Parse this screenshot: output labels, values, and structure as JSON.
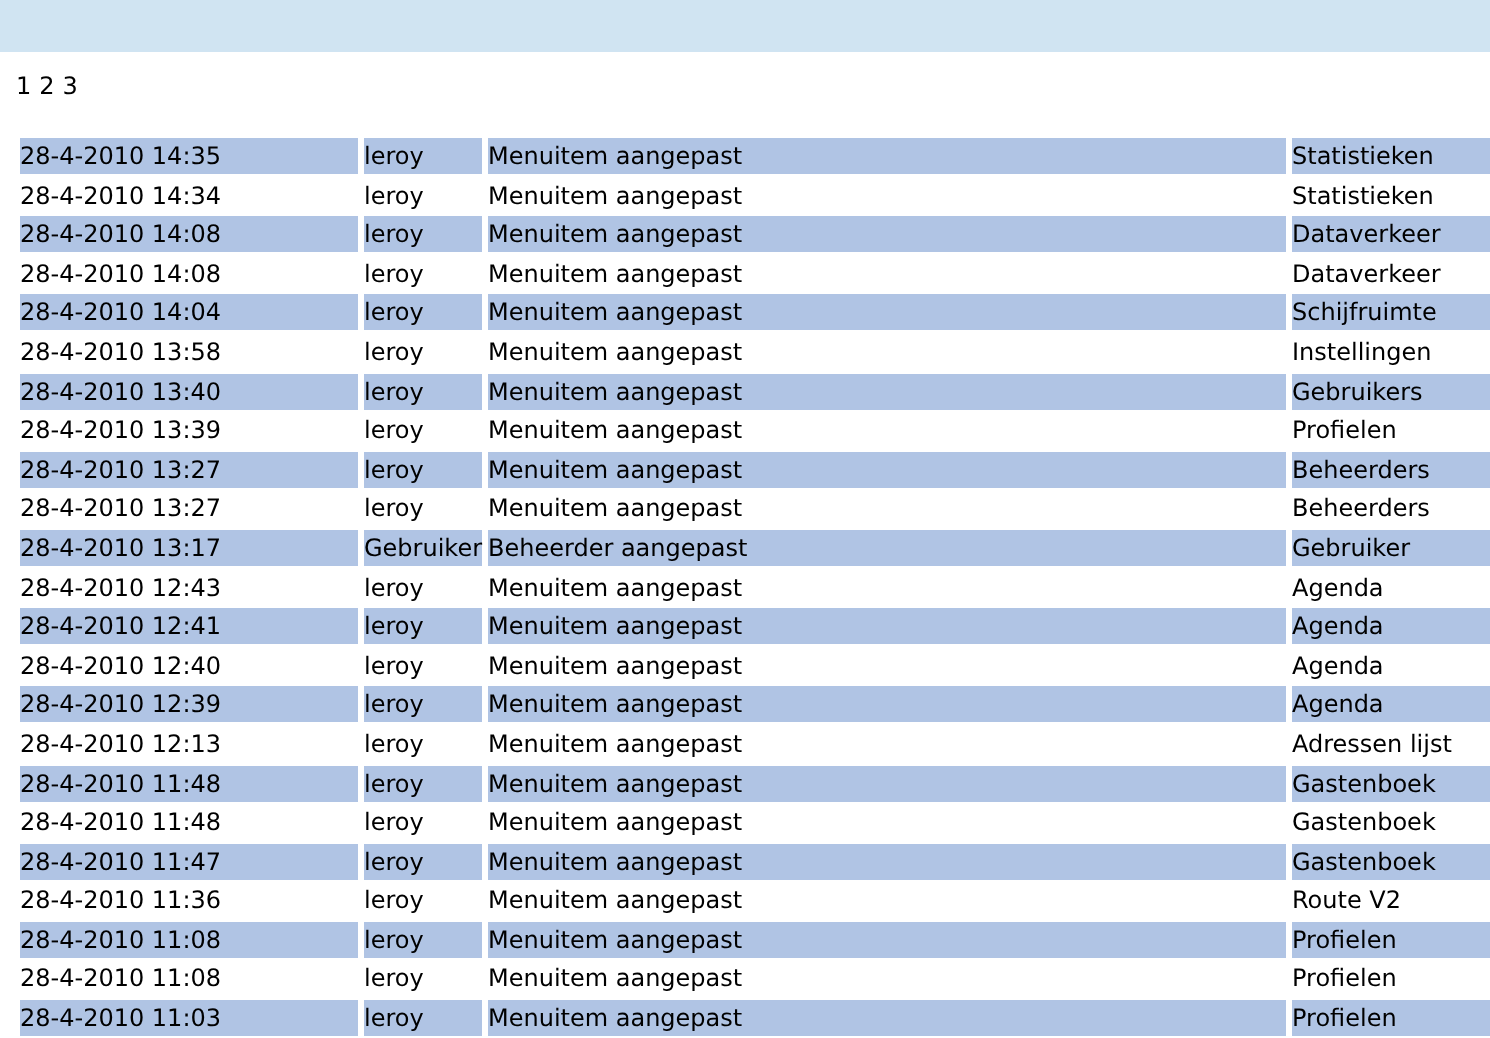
{
  "pages": [
    {
      "label": "1"
    },
    {
      "label": "2"
    },
    {
      "label": "3"
    }
  ],
  "rows": [
    {
      "date": "28-4-2010 14:35",
      "user": "leroy",
      "action": "Menuitem aangepast",
      "item": "Statistieken"
    },
    {
      "date": "28-4-2010 14:34",
      "user": "leroy",
      "action": "Menuitem aangepast",
      "item": "Statistieken"
    },
    {
      "date": "28-4-2010 14:08",
      "user": "leroy",
      "action": "Menuitem aangepast",
      "item": "Dataverkeer"
    },
    {
      "date": "28-4-2010 14:08",
      "user": "leroy",
      "action": "Menuitem aangepast",
      "item": "Dataverkeer"
    },
    {
      "date": "28-4-2010 14:04",
      "user": "leroy",
      "action": "Menuitem aangepast",
      "item": "Schijfruimte"
    },
    {
      "date": "28-4-2010 13:58",
      "user": "leroy",
      "action": "Menuitem aangepast",
      "item": "Instellingen"
    },
    {
      "date": "28-4-2010 13:40",
      "user": "leroy",
      "action": "Menuitem aangepast",
      "item": "Gebruikers"
    },
    {
      "date": "28-4-2010 13:39",
      "user": "leroy",
      "action": "Menuitem aangepast",
      "item": "Profielen"
    },
    {
      "date": "28-4-2010 13:27",
      "user": "leroy",
      "action": "Menuitem aangepast",
      "item": "Beheerders"
    },
    {
      "date": "28-4-2010 13:27",
      "user": "leroy",
      "action": "Menuitem aangepast",
      "item": "Beheerders"
    },
    {
      "date": "28-4-2010 13:17",
      "user": "Gebruiker",
      "action": "Beheerder aangepast",
      "item": "Gebruiker"
    },
    {
      "date": "28-4-2010 12:43",
      "user": "leroy",
      "action": "Menuitem aangepast",
      "item": "Agenda"
    },
    {
      "date": "28-4-2010 12:41",
      "user": "leroy",
      "action": "Menuitem aangepast",
      "item": "Agenda"
    },
    {
      "date": "28-4-2010 12:40",
      "user": "leroy",
      "action": "Menuitem aangepast",
      "item": "Agenda"
    },
    {
      "date": "28-4-2010 12:39",
      "user": "leroy",
      "action": "Menuitem aangepast",
      "item": "Agenda"
    },
    {
      "date": "28-4-2010 12:13",
      "user": "leroy",
      "action": "Menuitem aangepast",
      "item": "Adressen lijst"
    },
    {
      "date": "28-4-2010 11:48",
      "user": "leroy",
      "action": "Menuitem aangepast",
      "item": "Gastenboek"
    },
    {
      "date": "28-4-2010 11:48",
      "user": "leroy",
      "action": "Menuitem aangepast",
      "item": "Gastenboek"
    },
    {
      "date": "28-4-2010 11:47",
      "user": "leroy",
      "action": "Menuitem aangepast",
      "item": "Gastenboek"
    },
    {
      "date": "28-4-2010 11:36",
      "user": "leroy",
      "action": "Menuitem aangepast",
      "item": "Route V2"
    },
    {
      "date": "28-4-2010 11:08",
      "user": "leroy",
      "action": "Menuitem aangepast",
      "item": "Profielen"
    },
    {
      "date": "28-4-2010 11:08",
      "user": "leroy",
      "action": "Menuitem aangepast",
      "item": "Profielen"
    },
    {
      "date": "28-4-2010 11:03",
      "user": "leroy",
      "action": "Menuitem aangepast",
      "item": "Profielen"
    }
  ]
}
